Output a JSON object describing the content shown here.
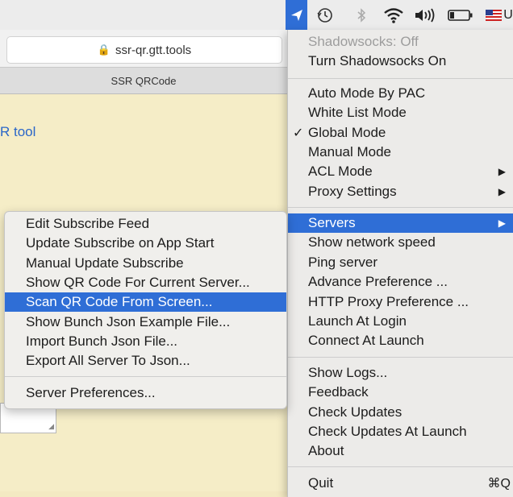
{
  "menubar": {
    "icons": [
      "paper-plane-icon",
      "time-machine-icon",
      "bluetooth-icon",
      "wifi-icon",
      "volume-icon",
      "battery-icon",
      "us-flag-icon"
    ],
    "trailing_text": "U"
  },
  "browser": {
    "url": "ssr-qr.gtt.tools",
    "tab_title": "SSR QRCode",
    "page_text_fragment": "R tool"
  },
  "main_menu": {
    "status": "Shadowsocks: Off",
    "toggle": "Turn Shadowsocks On",
    "items_mode": [
      {
        "label": "Auto Mode By PAC"
      },
      {
        "label": "White List Mode"
      },
      {
        "label": "Global Mode",
        "check": "✓"
      },
      {
        "label": "Manual Mode"
      },
      {
        "label": "ACL Mode",
        "arrow": "▶"
      },
      {
        "label": "Proxy Settings",
        "arrow": "▶"
      }
    ],
    "items_server": [
      {
        "label": "Servers",
        "arrow": "▶"
      },
      {
        "label": "Show network speed"
      },
      {
        "label": "Ping server"
      },
      {
        "label": "Advance Preference ..."
      },
      {
        "label": "HTTP Proxy Preference ..."
      },
      {
        "label": "Launch At Login"
      },
      {
        "label": "Connect At Launch"
      }
    ],
    "items_info": [
      {
        "label": "Show Logs..."
      },
      {
        "label": "Feedback"
      },
      {
        "label": "Check Updates"
      },
      {
        "label": "Check Updates At Launch"
      },
      {
        "label": "About"
      }
    ],
    "quit": {
      "label": "Quit",
      "shortcut": "⌘Q"
    }
  },
  "servers_submenu": {
    "items": [
      "Edit Subscribe Feed",
      "Update Subscribe on App Start",
      "Manual Update Subscribe",
      "Show QR Code For Current Server...",
      "Scan QR Code From Screen...",
      "Show Bunch Json Example File...",
      "Import Bunch Json File...",
      "Export All Server To Json..."
    ],
    "highlighted_index": 4,
    "footer": "Server Preferences..."
  },
  "colors": {
    "highlight": "#2f6ed6",
    "menu_bg": "#ecebe9",
    "page_bg": "#f5edc7",
    "link": "#2a66c8"
  }
}
